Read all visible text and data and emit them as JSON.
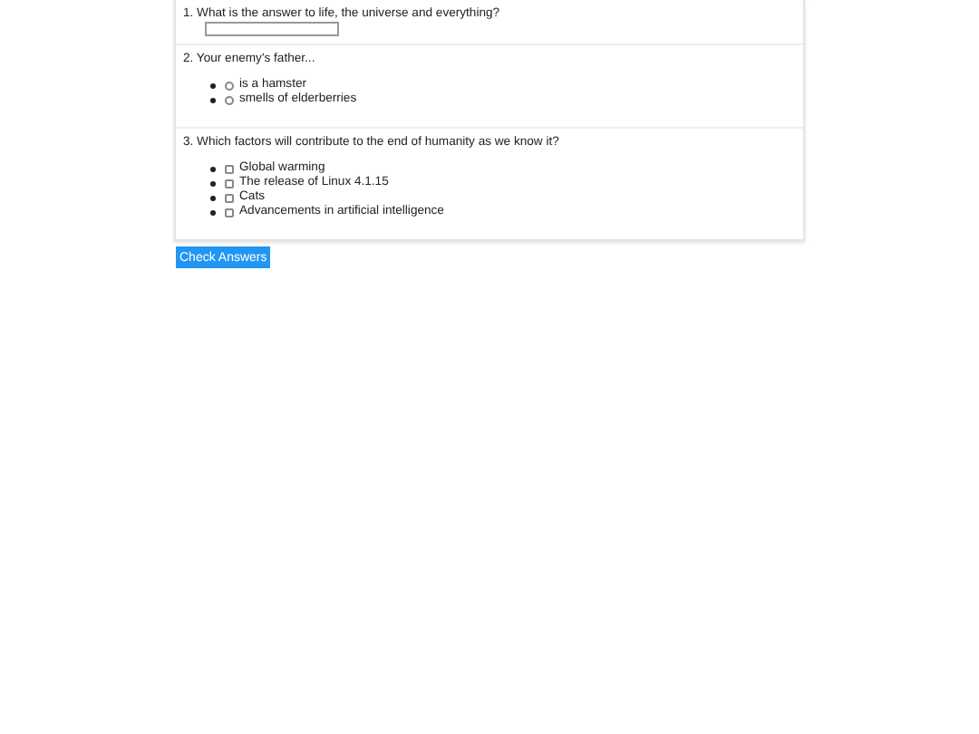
{
  "questions": [
    {
      "number": "1.",
      "text": "What is the answer to life, the universe and everything?",
      "kind": "text"
    },
    {
      "number": "2.",
      "text": "Your enemy's father...",
      "kind": "radio",
      "options": [
        {
          "label": "is a hamster",
          "selected": false
        },
        {
          "label": "smells of elderberries",
          "selected": false
        }
      ]
    },
    {
      "number": "3.",
      "text": "Which factors will contribute to the end of humanity as we know it?",
      "kind": "checkbox",
      "options": [
        {
          "label": "Global warming",
          "checked": false
        },
        {
          "label": "The release of Linux 4.1.15",
          "checked": false
        },
        {
          "label": "Cats",
          "checked": false
        },
        {
          "label": "Advancements in artificial intelligence",
          "checked": false
        }
      ]
    }
  ],
  "button": "Check Answers"
}
